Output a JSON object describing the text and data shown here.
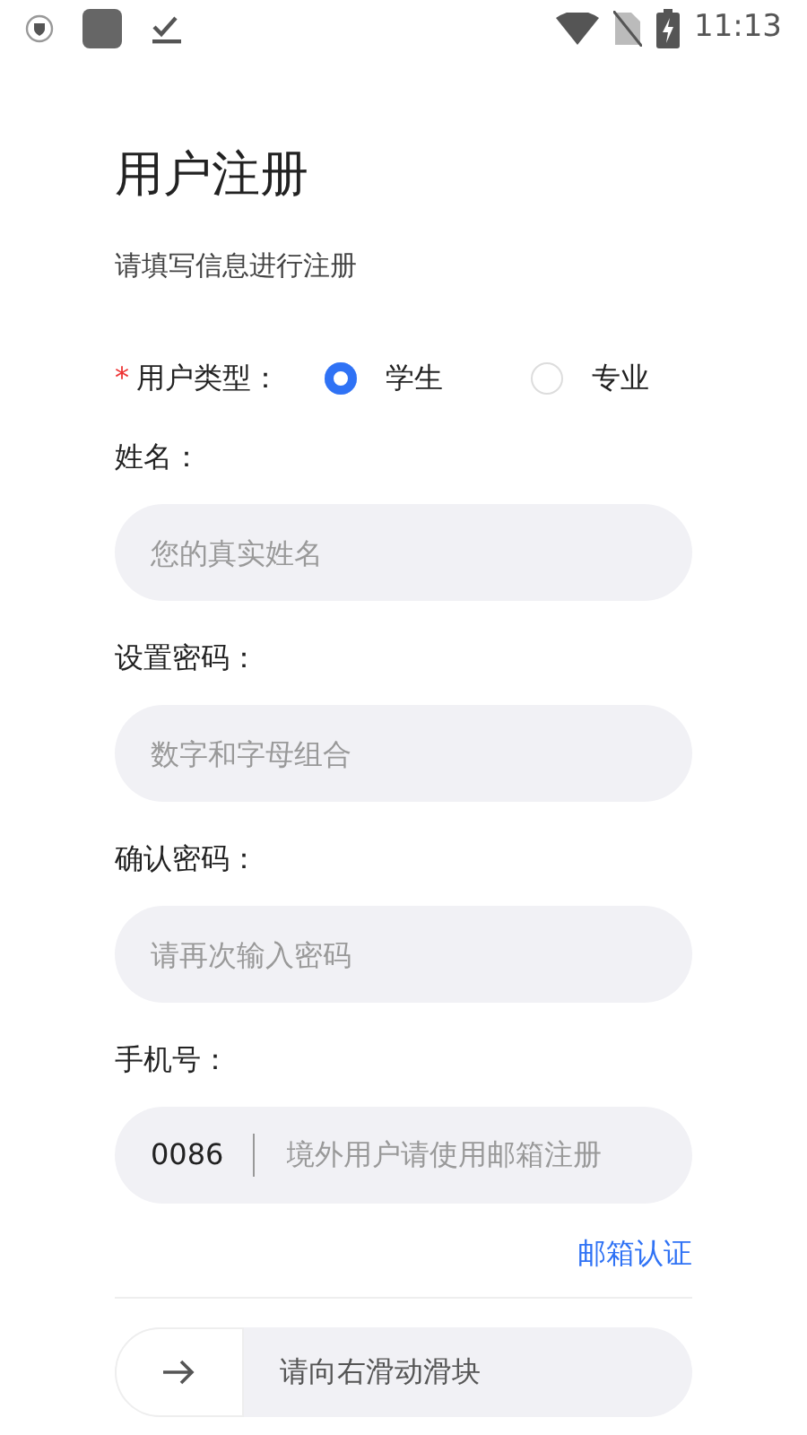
{
  "status_bar": {
    "time": "11:13"
  },
  "title": "用户注册",
  "subtitle": "请填写信息进行注册",
  "user_type": {
    "required_mark": "*",
    "label": "用户类型：",
    "options": [
      {
        "label": "学生",
        "selected": true
      },
      {
        "label": "专业",
        "selected": false
      }
    ]
  },
  "fields": [
    {
      "label": "姓名：",
      "placeholder": "您的真实姓名"
    },
    {
      "label": "设置密码：",
      "placeholder": "数字和字母组合"
    },
    {
      "label": "确认密码：",
      "placeholder": "请再次输入密码"
    }
  ],
  "phone": {
    "label": "手机号：",
    "prefix": "0086",
    "placeholder": "境外用户请使用邮箱注册"
  },
  "email_link": "邮箱认证",
  "slider": {
    "text": "请向右滑动滑块"
  }
}
